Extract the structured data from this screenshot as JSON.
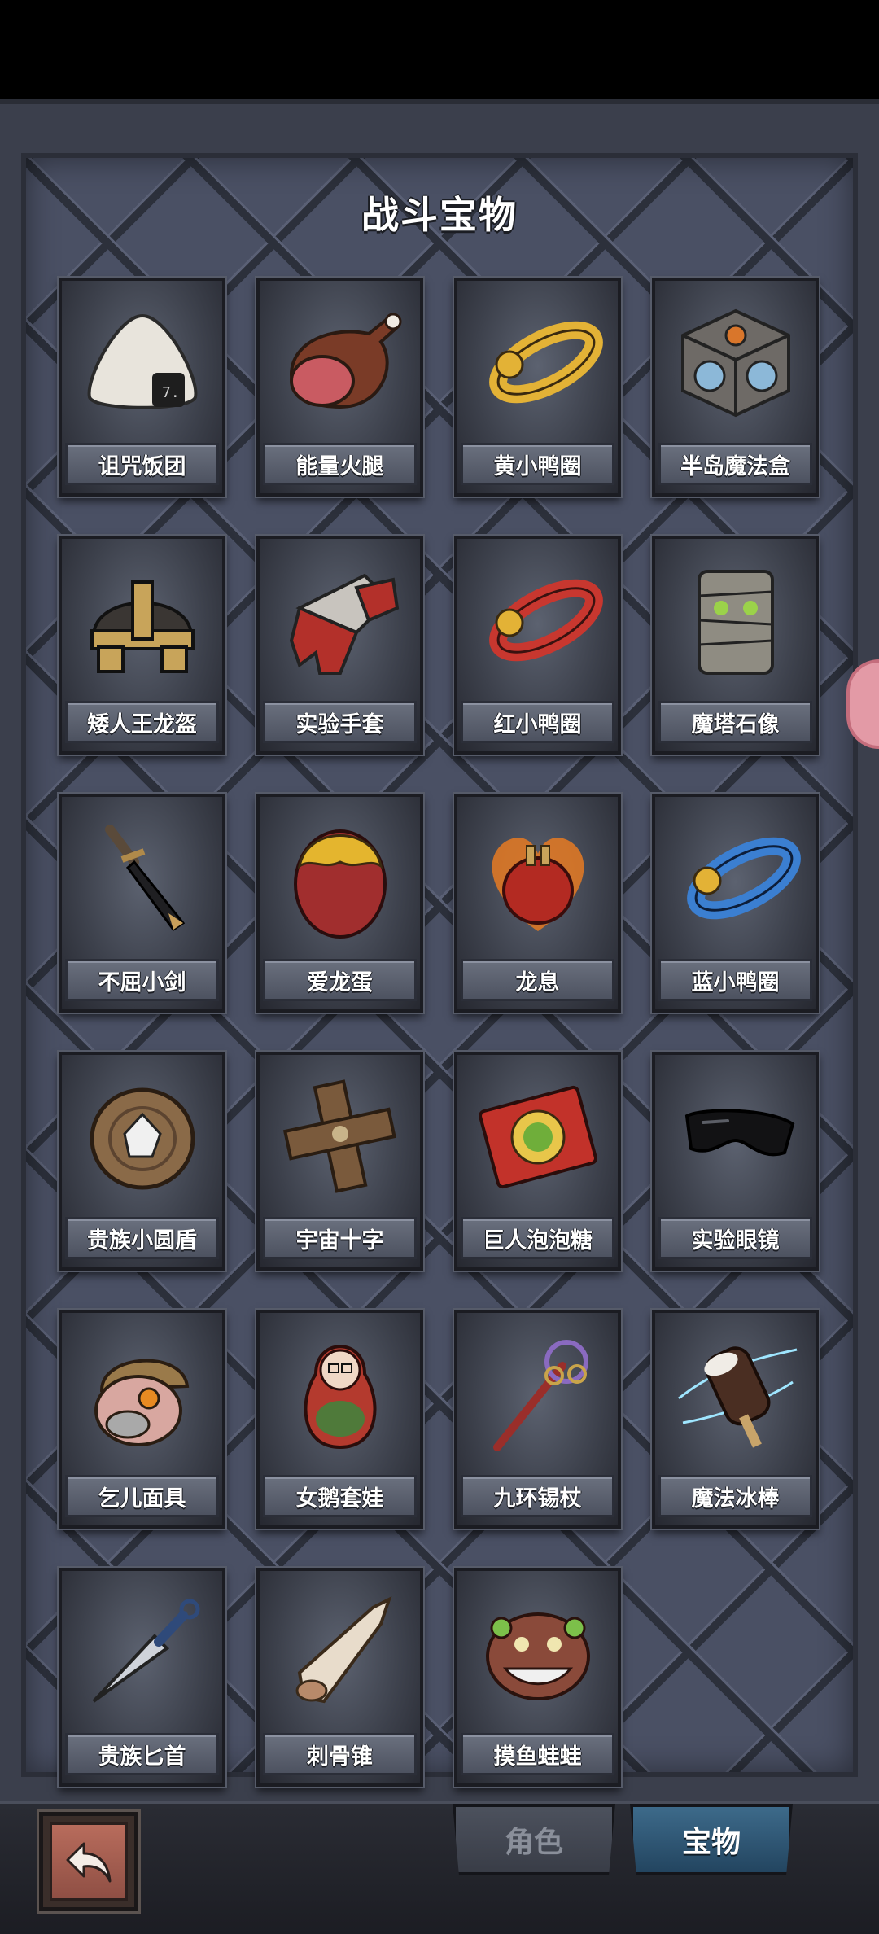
{
  "page": {
    "title": "战斗宝物"
  },
  "items": [
    {
      "label": "诅咒饭团",
      "icon": "rice-ball-icon"
    },
    {
      "label": "能量火腿",
      "icon": "ham-icon"
    },
    {
      "label": "黄小鸭圈",
      "icon": "yellow-duck-ring-icon"
    },
    {
      "label": "半岛魔法盒",
      "icon": "magic-cube-icon"
    },
    {
      "label": "矮人王龙盔",
      "icon": "dwarf-helmet-icon"
    },
    {
      "label": "实验手套",
      "icon": "glove-icon"
    },
    {
      "label": "红小鸭圈",
      "icon": "red-duck-ring-icon"
    },
    {
      "label": "魔塔石像",
      "icon": "stone-statue-icon"
    },
    {
      "label": "不屈小剑",
      "icon": "sword-icon"
    },
    {
      "label": "爱龙蛋",
      "icon": "dragon-egg-icon"
    },
    {
      "label": "龙息",
      "icon": "dragon-heart-icon"
    },
    {
      "label": "蓝小鸭圈",
      "icon": "blue-duck-ring-icon"
    },
    {
      "label": "贵族小圆盾",
      "icon": "shield-icon"
    },
    {
      "label": "宇宙十字",
      "icon": "wooden-cross-icon"
    },
    {
      "label": "巨人泡泡糖",
      "icon": "bubble-gum-icon"
    },
    {
      "label": "实验眼镜",
      "icon": "goggles-icon"
    },
    {
      "label": "乞儿面具",
      "icon": "beggar-mask-icon"
    },
    {
      "label": "女鹅套娃",
      "icon": "nesting-doll-icon"
    },
    {
      "label": "九环锡杖",
      "icon": "staff-icon"
    },
    {
      "label": "魔法冰棒",
      "icon": "ice-pop-icon"
    },
    {
      "label": "贵族匕首",
      "icon": "dagger-icon"
    },
    {
      "label": "刺骨锥",
      "icon": "bone-spike-icon"
    },
    {
      "label": "摸鱼蛙蛙",
      "icon": "frog-icon"
    }
  ],
  "bottom_bar": {
    "back_icon": "back-arrow-icon",
    "tabs": [
      {
        "label": "角色",
        "active": false
      },
      {
        "label": "宝物",
        "active": true
      }
    ]
  },
  "colors": {
    "panel_bg": "#4a5064",
    "active_tab": "#3d6a8a",
    "back_button": "#b86c5c"
  }
}
